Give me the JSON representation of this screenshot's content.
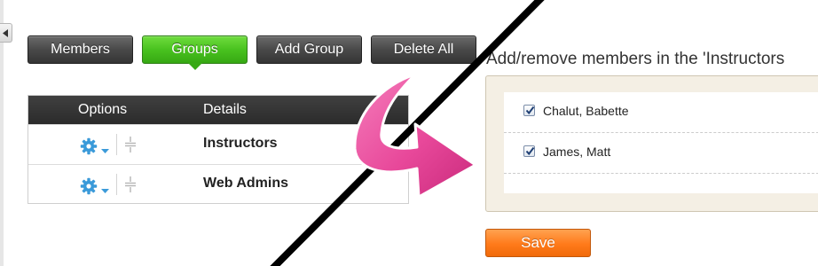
{
  "toolbar": {
    "members_label": "Members",
    "groups_label": "Groups",
    "add_group_label": "Add Group",
    "delete_all_label": "Delete All"
  },
  "table": {
    "headers": {
      "options": "Options",
      "details": "Details"
    },
    "rows": [
      {
        "name": "Instructors"
      },
      {
        "name": "Web Admins"
      }
    ]
  },
  "panel": {
    "heading": "Add/remove members in the 'Instructors",
    "members": [
      {
        "name": "Chalut, Babette",
        "checked": true
      },
      {
        "name": "James, Matt",
        "checked": true
      }
    ],
    "save_label": "Save"
  },
  "colors": {
    "accent_green": "#49c21f",
    "save_orange": "#ff7a1a",
    "arrow_pink": "#e8489a",
    "gear_blue": "#3a9ad9"
  },
  "icons": [
    "collapse-arrow-icon",
    "gear-icon",
    "chevron-down-icon",
    "drag-handle-icon",
    "checkbox-check-icon",
    "curved-arrow-icon"
  ]
}
